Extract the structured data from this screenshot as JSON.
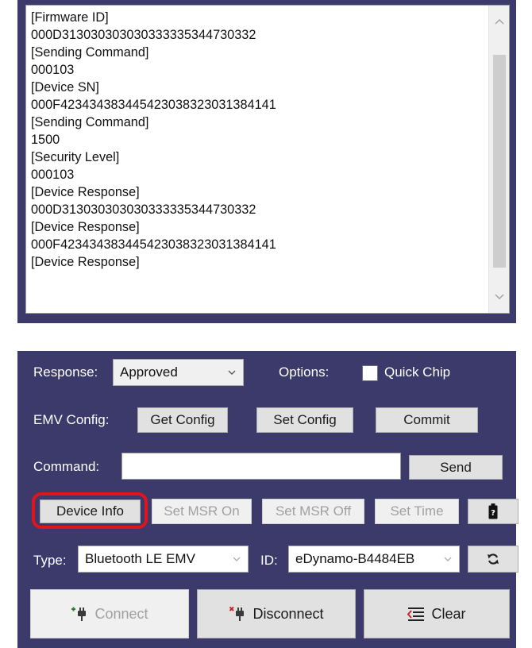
{
  "log": {
    "lines": [
      "[Firmware ID]",
      "000D313030303030333335344730332",
      "[Sending Command]",
      "000103",
      "[Device SN]",
      "000F423434383445423038323031384141",
      "[Sending Command]",
      "1500",
      "[Security Level]",
      "000103",
      "[Device Response]",
      "000D313030303030333335344730332",
      "[Device Response]",
      "000F423434383445423038323031384141",
      "[Device Response]"
    ]
  },
  "controls": {
    "response_label": "Response:",
    "response_value": "Approved",
    "options_label": "Options:",
    "quick_chip_label": "Quick Chip",
    "quick_chip_checked": false,
    "emv_config_label": "EMV Config:",
    "get_config": "Get Config",
    "set_config": "Set Config",
    "commit": "Commit",
    "command_label": "Command:",
    "command_value": "",
    "send": "Send",
    "device_info": "Device Info",
    "set_msr_on": "Set MSR On",
    "set_msr_off": "Set MSR Off",
    "set_time": "Set Time",
    "type_label": "Type:",
    "type_value": "Bluetooth LE EMV",
    "id_label": "ID:",
    "id_value": "eDynamo-B4484EB",
    "connect": "Connect",
    "disconnect": "Disconnect",
    "clear": "Clear"
  },
  "colors": {
    "panel_bg": "#3b3a6b",
    "highlight": "#e0141c",
    "connect_icon": "#2e7d32",
    "disconnect_icon": "#c62828"
  },
  "icons": {
    "battery": "battery-icon",
    "refresh": "refresh-icon",
    "connect": "plug-connect-icon",
    "disconnect": "plug-disconnect-icon",
    "clear": "clear-lines-icon",
    "scroll_up": "chevron-up-icon",
    "scroll_down": "chevron-down-icon"
  }
}
